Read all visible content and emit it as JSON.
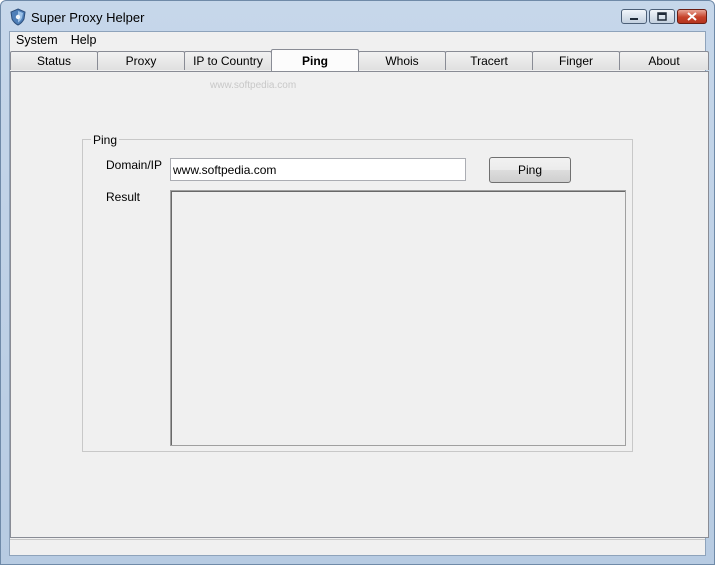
{
  "window": {
    "title": "Super Proxy Helper"
  },
  "menu": {
    "items": [
      "System",
      "Help"
    ]
  },
  "tabs": [
    {
      "label": "Status",
      "active": false
    },
    {
      "label": "Proxy",
      "active": false
    },
    {
      "label": "IP to Country",
      "active": false
    },
    {
      "label": "Ping",
      "active": true
    },
    {
      "label": "Whois",
      "active": false
    },
    {
      "label": "Tracert",
      "active": false
    },
    {
      "label": "Finger",
      "active": false
    },
    {
      "label": "About",
      "active": false
    }
  ],
  "ping": {
    "group_title": "Ping",
    "domain_label": "Domain/IP",
    "domain_value": "www.softpedia.com",
    "button_label": "Ping",
    "result_label": "Result",
    "result_value": ""
  },
  "watermark": "www.softpedia.com"
}
